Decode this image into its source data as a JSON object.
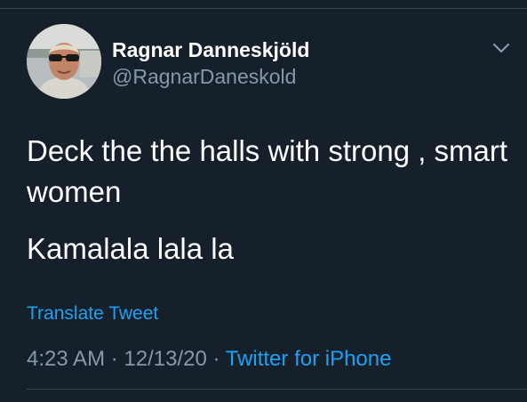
{
  "author": {
    "display_name": "Ragnar Danneskjöld",
    "handle": "@RagnarDaneskold"
  },
  "tweet": {
    "lines": [
      "Deck the the halls with strong , smart",
      "women",
      "Kamalala lala  la"
    ],
    "translate_label": "Translate Tweet"
  },
  "meta": {
    "time": "4:23 AM",
    "separator": " · ",
    "date": "12/13/20",
    "source": "Twitter for iPhone"
  },
  "icons": {
    "menu": "chevron-down-icon",
    "avatar": "profile-photo"
  },
  "colors": {
    "background": "#15202b",
    "text": "#ffffff",
    "secondary_text": "#8899a6",
    "link": "#1da1f2",
    "divider": "#38444d"
  }
}
